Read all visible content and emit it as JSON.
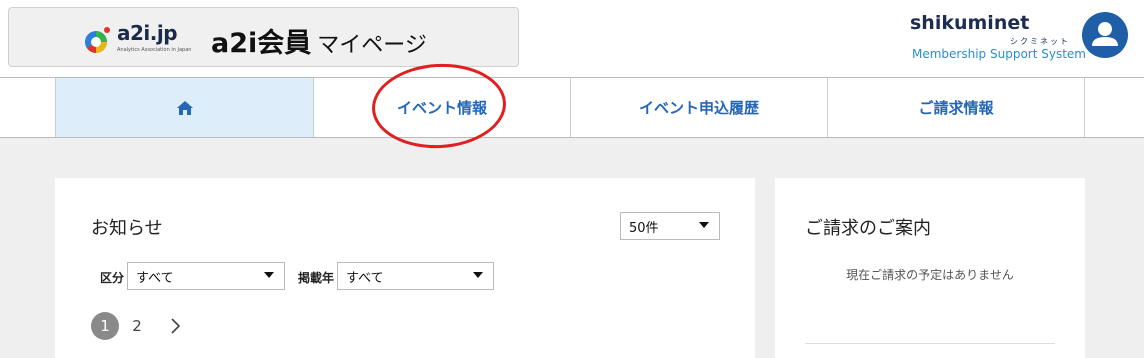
{
  "header": {
    "logo_text": "a2i.jp",
    "logo_sub": "Analytics Association in Japan",
    "site_title": "a2i会員",
    "site_title_sub": "マイページ"
  },
  "brand": {
    "name": "shikuminet",
    "kana": "シクミネット",
    "system": "Membership Support System",
    "accent_color": "#2a8fd0"
  },
  "nav": {
    "items": [
      {
        "icon": "home-icon"
      },
      {
        "label": "イベント情報"
      },
      {
        "label": "イベント申込履歴"
      },
      {
        "label": "ご請求情報"
      }
    ]
  },
  "news": {
    "title": "お知らせ",
    "per_page": "50件",
    "category_label": "区分",
    "category_value": "すべて",
    "year_label": "掲載年",
    "year_value": "すべて",
    "pager": {
      "current": "1",
      "next_page": "2"
    }
  },
  "billing": {
    "title": "ご請求のご案内",
    "message": "現在ご請求の予定はありません"
  }
}
